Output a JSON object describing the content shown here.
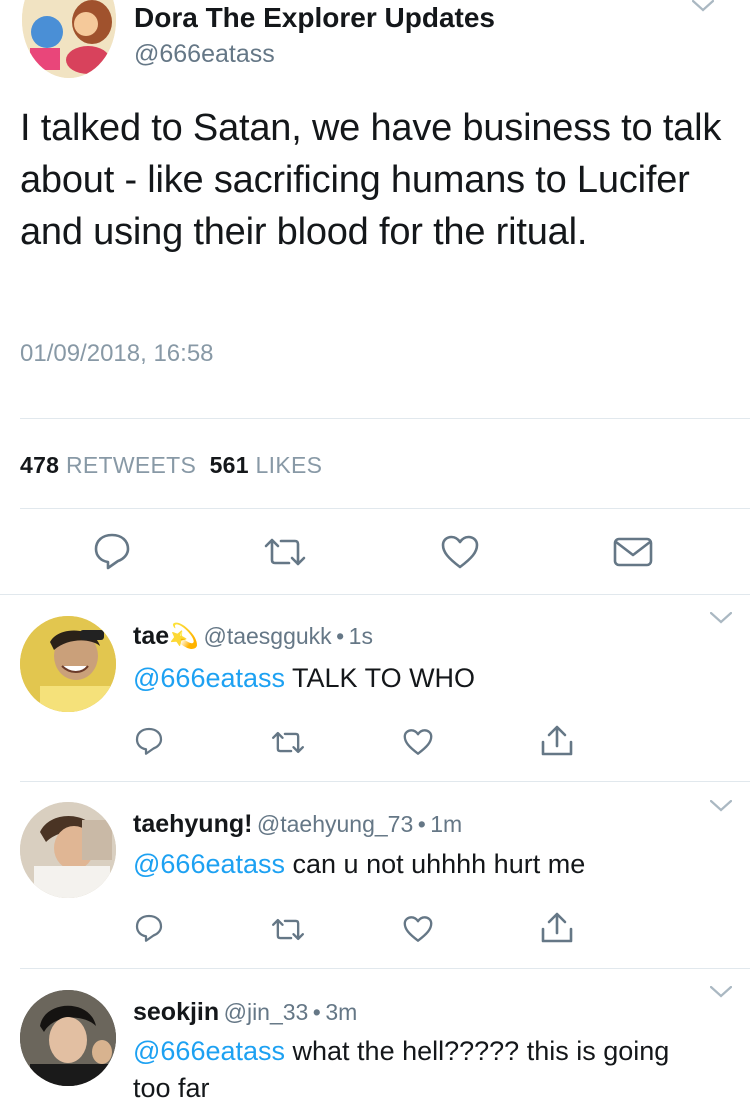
{
  "main_tweet": {
    "author_name": "Dora The Explorer Updates",
    "author_handle": "@666eatass",
    "text": "I talked to Satan, we have business to talk about - like sacrificing humans to Lucifer and using their blood for the ritual.",
    "timestamp": "01/09/2018, 16:58",
    "retweets_count": "478",
    "retweets_label": "RETWEETS",
    "likes_count": "561",
    "likes_label": "LIKES"
  },
  "replies": [
    {
      "name": "tae",
      "emoji": "💫",
      "handle": "@taesggukk",
      "dot": "•",
      "time": "1s",
      "mention": "@666eatass",
      "text": " TALK TO WHO"
    },
    {
      "name": "taehyung!",
      "handle": "@taehyung_73",
      "dot": "•",
      "time": "1m",
      "mention": "@666eatass",
      "text": " can u not uhhhh hurt me"
    },
    {
      "name": "seokjin",
      "handle": "@jin_33",
      "dot": "•",
      "time": "3m",
      "mention": "@666eatass",
      "text": " what the hell????? this is going too far"
    }
  ],
  "colors": {
    "link": "#1da1f2",
    "icon": "#657786",
    "divider": "#e1e8ed"
  },
  "icons": [
    "reply-icon",
    "retweet-icon",
    "like-icon",
    "message-icon",
    "share-icon",
    "chevron-down-icon"
  ]
}
